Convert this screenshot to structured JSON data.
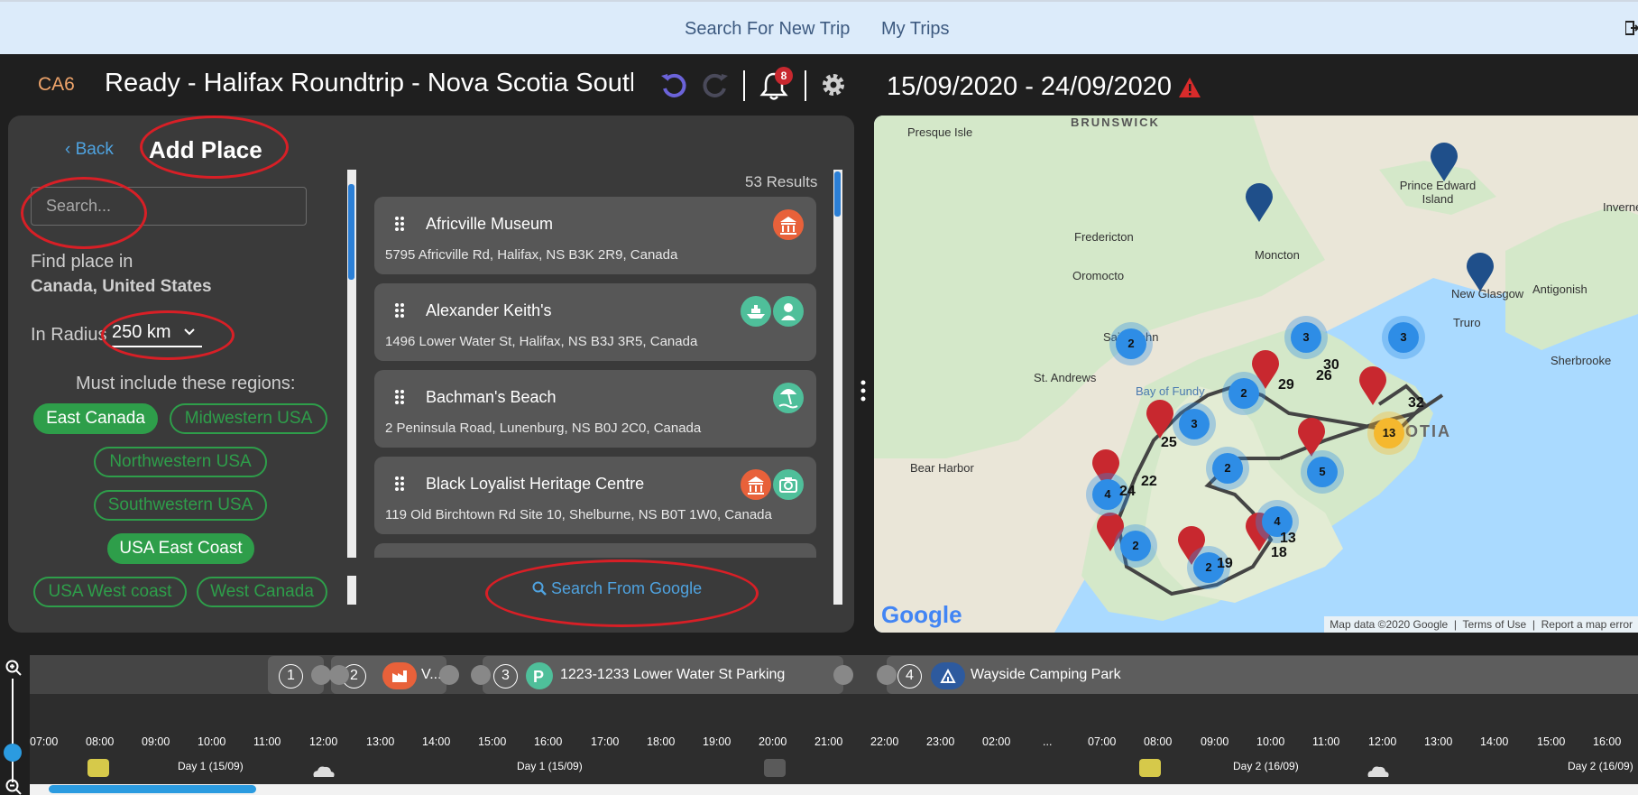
{
  "nav": {
    "search_trip": "Search For New Trip",
    "my_trips": "My Trips"
  },
  "header": {
    "trip_code": "CA6",
    "title": "Ready - Halifax Roundtrip - Nova Scotia Southern Shore",
    "notification_count": "8",
    "dates": "15/09/2020 - 24/09/2020",
    "icons": [
      "undo-icon",
      "redo-icon",
      "bell-icon",
      "gear-icon",
      "warning-icon"
    ]
  },
  "panel": {
    "back_label": "Back",
    "title": "Add Place",
    "search_placeholder": "Search...",
    "find_label": "Find place in",
    "find_value": "Canada, United States",
    "radius_label": "In Radius",
    "radius_value": "250 km",
    "regions_label": "Must include these regions:",
    "regions": [
      {
        "label": "East Canada",
        "active": true
      },
      {
        "label": "Midwestern USA",
        "active": false
      },
      {
        "label": "Northwestern USA",
        "active": false
      },
      {
        "label": "Southwestern USA",
        "active": false
      },
      {
        "label": "USA East Coast",
        "active": true
      },
      {
        "label": "USA West coast",
        "active": false
      },
      {
        "label": "West Canada",
        "active": false
      }
    ]
  },
  "results": {
    "count_label": "53 Results",
    "google_label": "Search From Google",
    "items": [
      {
        "name": "Africville Museum",
        "address": "5795 Africville Rd, Halifax, NS B3K 2R9, Canada",
        "icons": [
          "museum-icon"
        ]
      },
      {
        "name": "Alexander Keith's",
        "address": "1496 Lower Water St, Halifax, NS B3J 3R5, Canada",
        "icons": [
          "boat-tour-icon",
          "guide-icon"
        ]
      },
      {
        "name": "Bachman's Beach",
        "address": "2 Peninsula Road, Lunenburg, NS B0J 2C0, Canada",
        "icons": [
          "beach-icon"
        ]
      },
      {
        "name": "Black Loyalist Heritage Centre",
        "address": "119 Old Birchtown Rd Site 10, Shelburne, NS B0T 1W0, Canada",
        "icons": [
          "museum-icon",
          "camera-icon"
        ]
      }
    ]
  },
  "map": {
    "labels": [
      "BRUNSWICK",
      "Presque Isle",
      "Fredericton",
      "Oromocto",
      "Moncton",
      "Prince Edward Island",
      "Inverness",
      "New Glasgow",
      "Antigonish",
      "Truro",
      "Sherbrooke",
      "Saint John",
      "St. Andrews",
      "Bay of Fundy",
      "Bear Harbor",
      "SCOTIA"
    ],
    "clusters": [
      {
        "label": "2",
        "kind": "blue"
      },
      {
        "label": "2",
        "kind": "blue"
      },
      {
        "label": "2",
        "kind": "blue"
      },
      {
        "label": "3",
        "kind": "blue"
      },
      {
        "label": "3",
        "kind": "blue"
      },
      {
        "label": "2",
        "kind": "blue"
      },
      {
        "label": "3",
        "kind": "blue"
      },
      {
        "label": "2",
        "kind": "blue"
      },
      {
        "label": "5",
        "kind": "blue"
      },
      {
        "label": "4",
        "kind": "blue"
      },
      {
        "label": "4",
        "kind": "blue"
      },
      {
        "label": "2",
        "kind": "blue"
      },
      {
        "label": "2",
        "kind": "blue"
      },
      {
        "label": "13",
        "kind": "yellow"
      }
    ],
    "route_numbers": [
      "29",
      "30",
      "26",
      "32",
      "22",
      "24",
      "25",
      "18",
      "19",
      "13"
    ],
    "footer": {
      "data": "Map data ©2020 Google",
      "terms": "Terms of Use",
      "report": "Report a map error"
    },
    "logo": "Google"
  },
  "timeline": {
    "stops": [
      {
        "num": "1",
        "label": ""
      },
      {
        "num": "2",
        "label": "V..."
      },
      {
        "num": "3",
        "label": "1223-1233 Lower Water St Parking"
      },
      {
        "num": "4",
        "label": "Wayside Camping Park"
      }
    ],
    "hours": [
      "07:00",
      "08:00",
      "09:00",
      "10:00",
      "11:00",
      "12:00",
      "13:00",
      "14:00",
      "15:00",
      "16:00",
      "17:00",
      "18:00",
      "19:00",
      "20:00",
      "21:00",
      "22:00",
      "23:00",
      "02:00",
      "...",
      "07:00",
      "08:00",
      "09:00",
      "10:00",
      "11:00",
      "12:00",
      "13:00",
      "14:00",
      "15:00",
      "16:00"
    ],
    "days": [
      "Day 1 (15/09)",
      "Day 1 (15/09)",
      "Day 2 (16/09)",
      "Day 2 (16/09)"
    ]
  }
}
